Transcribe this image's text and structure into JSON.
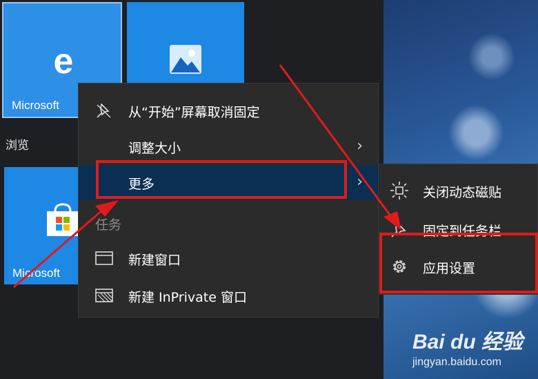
{
  "tiles": {
    "edge": {
      "label": "Microsoft",
      "icon": "edge-icon"
    },
    "photos": {
      "icon": "photos-icon"
    },
    "store": {
      "label": "Microsoft",
      "icon": "store-icon"
    },
    "group_label": "浏览"
  },
  "context_menu": {
    "items": [
      {
        "label": "从“开始”屏幕取消固定",
        "icon": "unpin-icon"
      },
      {
        "label": "调整大小",
        "chevron": "›"
      },
      {
        "label": "更多",
        "chevron": "›",
        "highlighted": true
      }
    ],
    "section_label": "任务",
    "tasks": [
      {
        "label": "新建窗口",
        "icon": "window-icon"
      },
      {
        "label": "新建 InPrivate 窗口",
        "icon": "inprivate-window-icon"
      }
    ]
  },
  "submenu": {
    "items": [
      {
        "label": "关闭动态磁贴",
        "icon": "live-tile-icon"
      },
      {
        "label": "固定到任务栏",
        "icon": "pin-taskbar-icon"
      },
      {
        "label": "应用设置",
        "icon": "gear-icon"
      }
    ]
  },
  "watermark": {
    "brand": "Bai du 经验",
    "url": "jingyan.baidu.com"
  },
  "colors": {
    "tile": "#1e88e5",
    "menu_bg": "#2b2b2b",
    "highlight": "#0a2f52",
    "annotation": "#e01b1b"
  }
}
